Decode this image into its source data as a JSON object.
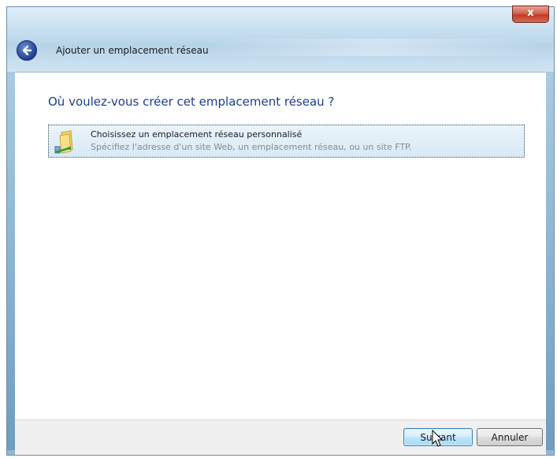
{
  "window": {
    "close_glyph": "x",
    "wizard_title": "Ajouter un emplacement réseau"
  },
  "content": {
    "question": "Où voulez-vous créer cet emplacement réseau ?",
    "option": {
      "icon": "folder-network-icon",
      "title": "Choisissez un emplacement réseau personnalisé",
      "description": "Spécifiez l'adresse d'un site Web, un emplacement réseau, ou un site FTP."
    }
  },
  "footer": {
    "next_label": "Suivant",
    "cancel_label": "Annuler"
  },
  "colors": {
    "question_text": "#1a3d8f",
    "option_bg": "#d7e9f6",
    "close_button": "#c0392b"
  }
}
